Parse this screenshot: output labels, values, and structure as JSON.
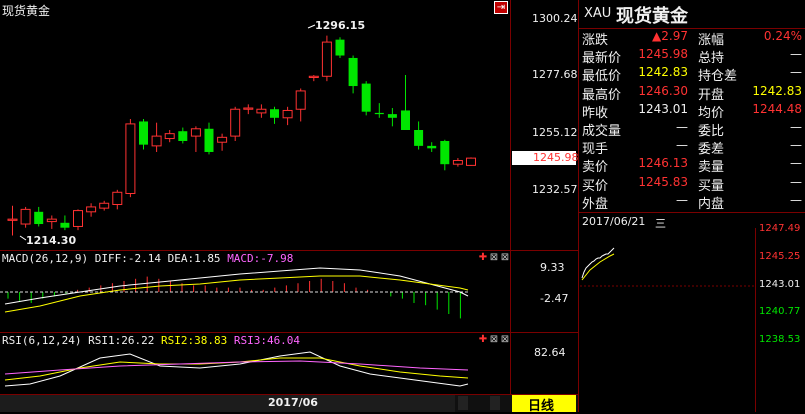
{
  "main_chart": {
    "title": "现货黄金",
    "high_label": "1296.15",
    "low_label": "1214.30",
    "y_ticks": [
      "1300.24",
      "1277.68",
      "1255.12",
      "1232.57"
    ],
    "price_tag": "1245.98"
  },
  "macd": {
    "prefix": "MACD(26,12,9)",
    "diff": "DIFF:-2.14",
    "dea": "DEA:1.85",
    "macd_val": "MACD:-7.98",
    "y_ticks": [
      "9.33",
      "-2.47"
    ]
  },
  "rsi": {
    "prefix": "RSI(6,12,24)",
    "rsi1": "RSI1:26.22",
    "rsi2": "RSI2:38.83",
    "rsi3": "RSI3:46.04",
    "y_ticks": [
      "82.64"
    ]
  },
  "bottom": {
    "date_label": "2017/06",
    "period_button": "日线"
  },
  "quote": {
    "symbol": "XAU",
    "name": "现货黄金",
    "rows": [
      [
        {
          "t": "涨跌",
          "c": "white"
        },
        {
          "t": "▲2.97",
          "c": "red"
        },
        {
          "t": "涨幅",
          "c": "white"
        },
        {
          "t": "0.24%",
          "c": "red"
        }
      ],
      [
        {
          "t": "最新价",
          "c": "white"
        },
        {
          "t": "1245.98",
          "c": "red"
        },
        {
          "t": "总持",
          "c": "white"
        },
        {
          "t": "—",
          "c": "white"
        }
      ],
      [
        {
          "t": "最低价",
          "c": "white"
        },
        {
          "t": "1242.83",
          "c": "yellow"
        },
        {
          "t": "持仓差",
          "c": "white"
        },
        {
          "t": "—",
          "c": "white"
        }
      ],
      [
        {
          "t": "最高价",
          "c": "white"
        },
        {
          "t": "1246.30",
          "c": "red"
        },
        {
          "t": "开盘",
          "c": "white"
        },
        {
          "t": "1242.83",
          "c": "yellow"
        }
      ],
      [
        {
          "t": "昨收",
          "c": "white"
        },
        {
          "t": "1243.01",
          "c": "white"
        },
        {
          "t": "均价",
          "c": "white"
        },
        {
          "t": "1244.48",
          "c": "red"
        }
      ],
      [
        {
          "t": "成交量",
          "c": "white"
        },
        {
          "t": "—",
          "c": "white"
        },
        {
          "t": "委比",
          "c": "white"
        },
        {
          "t": "—",
          "c": "white"
        }
      ],
      [
        {
          "t": "现手",
          "c": "white"
        },
        {
          "t": "—",
          "c": "white"
        },
        {
          "t": "委差",
          "c": "white"
        },
        {
          "t": "—",
          "c": "white"
        }
      ],
      [
        {
          "t": "卖价",
          "c": "white"
        },
        {
          "t": "1246.13",
          "c": "red"
        },
        {
          "t": "卖量",
          "c": "white"
        },
        {
          "t": "—",
          "c": "white"
        }
      ],
      [
        {
          "t": "买价",
          "c": "white"
        },
        {
          "t": "1245.83",
          "c": "red"
        },
        {
          "t": "买量",
          "c": "white"
        },
        {
          "t": "—",
          "c": "white"
        }
      ],
      [
        {
          "t": "外盘",
          "c": "white"
        },
        {
          "t": "—",
          "c": "white"
        },
        {
          "t": "内盘",
          "c": "white"
        },
        {
          "t": "—",
          "c": "white"
        }
      ]
    ]
  },
  "intraday": {
    "date": "2017/06/21",
    "weekday": "三",
    "y_ticks": [
      {
        "t": "1247.49",
        "c": "red"
      },
      {
        "t": "1245.25",
        "c": "red"
      },
      {
        "t": "1243.01",
        "c": "white"
      },
      {
        "t": "1240.77",
        "c": "green"
      },
      {
        "t": "1238.53",
        "c": "green"
      }
    ]
  },
  "colors": {
    "up": "#ff3232",
    "down": "#00e600",
    "grid": "#7a0000",
    "yellow": "#ffff00"
  },
  "chart_data": {
    "type": "candlestick",
    "unit": "price",
    "ylim": [
      1210,
      1305
    ],
    "candles": [
      {
        "o": 1220.5,
        "h": 1226.5,
        "l": 1214.3,
        "c": 1221.0
      },
      {
        "o": 1219.0,
        "h": 1226.0,
        "l": 1217.5,
        "c": 1225.0
      },
      {
        "o": 1224.0,
        "h": 1226.0,
        "l": 1218.0,
        "c": 1219.0
      },
      {
        "o": 1220.0,
        "h": 1222.5,
        "l": 1217.0,
        "c": 1221.0
      },
      {
        "o": 1219.5,
        "h": 1222.5,
        "l": 1216.5,
        "c": 1217.5
      },
      {
        "o": 1218.0,
        "h": 1225.0,
        "l": 1216.5,
        "c": 1224.5
      },
      {
        "o": 1224.0,
        "h": 1227.5,
        "l": 1222.0,
        "c": 1226.0
      },
      {
        "o": 1225.5,
        "h": 1228.5,
        "l": 1224.5,
        "c": 1227.5
      },
      {
        "o": 1227.0,
        "h": 1233.0,
        "l": 1225.0,
        "c": 1232.0
      },
      {
        "o": 1231.5,
        "h": 1262.0,
        "l": 1230.0,
        "c": 1260.0
      },
      {
        "o": 1261.0,
        "h": 1262.0,
        "l": 1249.5,
        "c": 1251.5
      },
      {
        "o": 1251.0,
        "h": 1260.5,
        "l": 1248.5,
        "c": 1255.0
      },
      {
        "o": 1254.0,
        "h": 1257.5,
        "l": 1252.5,
        "c": 1256.0
      },
      {
        "o": 1257.0,
        "h": 1258.5,
        "l": 1252.0,
        "c": 1253.0
      },
      {
        "o": 1255.0,
        "h": 1259.0,
        "l": 1248.5,
        "c": 1258.0
      },
      {
        "o": 1258.0,
        "h": 1260.5,
        "l": 1247.5,
        "c": 1248.5
      },
      {
        "o": 1252.5,
        "h": 1256.0,
        "l": 1249.0,
        "c": 1254.5
      },
      {
        "o": 1255.0,
        "h": 1267.0,
        "l": 1253.0,
        "c": 1266.0
      },
      {
        "o": 1266.0,
        "h": 1268.0,
        "l": 1264.0,
        "c": 1266.5
      },
      {
        "o": 1264.5,
        "h": 1268.0,
        "l": 1262.5,
        "c": 1266.0
      },
      {
        "o": 1266.0,
        "h": 1267.0,
        "l": 1260.0,
        "c": 1262.5
      },
      {
        "o": 1262.5,
        "h": 1267.0,
        "l": 1259.5,
        "c": 1265.5
      },
      {
        "o": 1266.0,
        "h": 1274.5,
        "l": 1261.0,
        "c": 1273.5
      },
      {
        "o": 1279.0,
        "h": 1280.0,
        "l": 1277.5,
        "c": 1279.5
      },
      {
        "o": 1279.5,
        "h": 1296.15,
        "l": 1277.5,
        "c": 1293.5
      },
      {
        "o": 1294.5,
        "h": 1295.5,
        "l": 1287.0,
        "c": 1288.0
      },
      {
        "o": 1287.0,
        "h": 1288.0,
        "l": 1272.5,
        "c": 1275.5
      },
      {
        "o": 1276.5,
        "h": 1277.5,
        "l": 1263.5,
        "c": 1265.0
      },
      {
        "o": 1264.5,
        "h": 1268.5,
        "l": 1262.5,
        "c": 1264.0
      },
      {
        "o": 1264.0,
        "h": 1266.5,
        "l": 1259.0,
        "c": 1262.5
      },
      {
        "o": 1265.5,
        "h": 1280.0,
        "l": 1258.5,
        "c": 1257.5
      },
      {
        "o": 1257.5,
        "h": 1261.0,
        "l": 1249.5,
        "c": 1251.0
      },
      {
        "o": 1251.0,
        "h": 1252.5,
        "l": 1248.5,
        "c": 1250.0
      },
      {
        "o": 1253.0,
        "h": 1253.5,
        "l": 1241.0,
        "c": 1243.5
      },
      {
        "o": 1243.5,
        "h": 1246.0,
        "l": 1242.5,
        "c": 1245.0
      },
      {
        "o": 1243.01,
        "h": 1246.3,
        "l": 1242.83,
        "c": 1245.98
      }
    ]
  }
}
